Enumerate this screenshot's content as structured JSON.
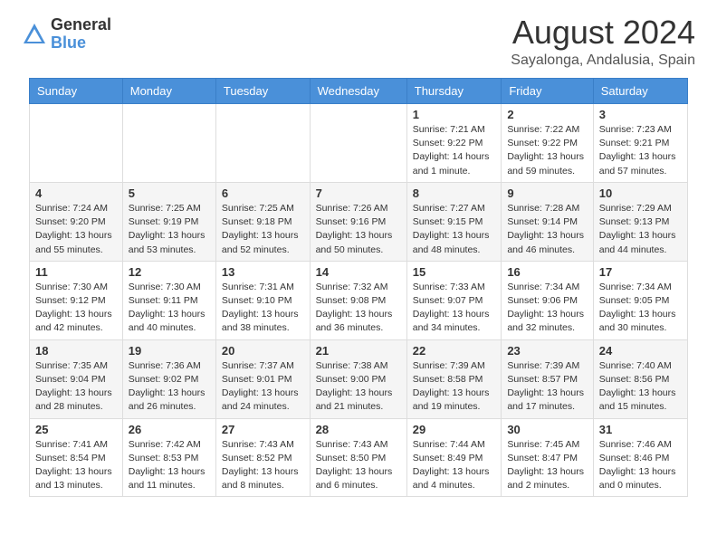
{
  "logo": {
    "general": "General",
    "blue": "Blue"
  },
  "header": {
    "month_year": "August 2024",
    "location": "Sayalonga, Andalusia, Spain"
  },
  "days_of_week": [
    "Sunday",
    "Monday",
    "Tuesday",
    "Wednesday",
    "Thursday",
    "Friday",
    "Saturday"
  ],
  "weeks": [
    [
      {
        "day": "",
        "info": ""
      },
      {
        "day": "",
        "info": ""
      },
      {
        "day": "",
        "info": ""
      },
      {
        "day": "",
        "info": ""
      },
      {
        "day": "1",
        "info": "Sunrise: 7:21 AM\nSunset: 9:22 PM\nDaylight: 14 hours\nand 1 minute."
      },
      {
        "day": "2",
        "info": "Sunrise: 7:22 AM\nSunset: 9:22 PM\nDaylight: 13 hours\nand 59 minutes."
      },
      {
        "day": "3",
        "info": "Sunrise: 7:23 AM\nSunset: 9:21 PM\nDaylight: 13 hours\nand 57 minutes."
      }
    ],
    [
      {
        "day": "4",
        "info": "Sunrise: 7:24 AM\nSunset: 9:20 PM\nDaylight: 13 hours\nand 55 minutes."
      },
      {
        "day": "5",
        "info": "Sunrise: 7:25 AM\nSunset: 9:19 PM\nDaylight: 13 hours\nand 53 minutes."
      },
      {
        "day": "6",
        "info": "Sunrise: 7:25 AM\nSunset: 9:18 PM\nDaylight: 13 hours\nand 52 minutes."
      },
      {
        "day": "7",
        "info": "Sunrise: 7:26 AM\nSunset: 9:16 PM\nDaylight: 13 hours\nand 50 minutes."
      },
      {
        "day": "8",
        "info": "Sunrise: 7:27 AM\nSunset: 9:15 PM\nDaylight: 13 hours\nand 48 minutes."
      },
      {
        "day": "9",
        "info": "Sunrise: 7:28 AM\nSunset: 9:14 PM\nDaylight: 13 hours\nand 46 minutes."
      },
      {
        "day": "10",
        "info": "Sunrise: 7:29 AM\nSunset: 9:13 PM\nDaylight: 13 hours\nand 44 minutes."
      }
    ],
    [
      {
        "day": "11",
        "info": "Sunrise: 7:30 AM\nSunset: 9:12 PM\nDaylight: 13 hours\nand 42 minutes."
      },
      {
        "day": "12",
        "info": "Sunrise: 7:30 AM\nSunset: 9:11 PM\nDaylight: 13 hours\nand 40 minutes."
      },
      {
        "day": "13",
        "info": "Sunrise: 7:31 AM\nSunset: 9:10 PM\nDaylight: 13 hours\nand 38 minutes."
      },
      {
        "day": "14",
        "info": "Sunrise: 7:32 AM\nSunset: 9:08 PM\nDaylight: 13 hours\nand 36 minutes."
      },
      {
        "day": "15",
        "info": "Sunrise: 7:33 AM\nSunset: 9:07 PM\nDaylight: 13 hours\nand 34 minutes."
      },
      {
        "day": "16",
        "info": "Sunrise: 7:34 AM\nSunset: 9:06 PM\nDaylight: 13 hours\nand 32 minutes."
      },
      {
        "day": "17",
        "info": "Sunrise: 7:34 AM\nSunset: 9:05 PM\nDaylight: 13 hours\nand 30 minutes."
      }
    ],
    [
      {
        "day": "18",
        "info": "Sunrise: 7:35 AM\nSunset: 9:04 PM\nDaylight: 13 hours\nand 28 minutes."
      },
      {
        "day": "19",
        "info": "Sunrise: 7:36 AM\nSunset: 9:02 PM\nDaylight: 13 hours\nand 26 minutes."
      },
      {
        "day": "20",
        "info": "Sunrise: 7:37 AM\nSunset: 9:01 PM\nDaylight: 13 hours\nand 24 minutes."
      },
      {
        "day": "21",
        "info": "Sunrise: 7:38 AM\nSunset: 9:00 PM\nDaylight: 13 hours\nand 21 minutes."
      },
      {
        "day": "22",
        "info": "Sunrise: 7:39 AM\nSunset: 8:58 PM\nDaylight: 13 hours\nand 19 minutes."
      },
      {
        "day": "23",
        "info": "Sunrise: 7:39 AM\nSunset: 8:57 PM\nDaylight: 13 hours\nand 17 minutes."
      },
      {
        "day": "24",
        "info": "Sunrise: 7:40 AM\nSunset: 8:56 PM\nDaylight: 13 hours\nand 15 minutes."
      }
    ],
    [
      {
        "day": "25",
        "info": "Sunrise: 7:41 AM\nSunset: 8:54 PM\nDaylight: 13 hours\nand 13 minutes."
      },
      {
        "day": "26",
        "info": "Sunrise: 7:42 AM\nSunset: 8:53 PM\nDaylight: 13 hours\nand 11 minutes."
      },
      {
        "day": "27",
        "info": "Sunrise: 7:43 AM\nSunset: 8:52 PM\nDaylight: 13 hours\nand 8 minutes."
      },
      {
        "day": "28",
        "info": "Sunrise: 7:43 AM\nSunset: 8:50 PM\nDaylight: 13 hours\nand 6 minutes."
      },
      {
        "day": "29",
        "info": "Sunrise: 7:44 AM\nSunset: 8:49 PM\nDaylight: 13 hours\nand 4 minutes."
      },
      {
        "day": "30",
        "info": "Sunrise: 7:45 AM\nSunset: 8:47 PM\nDaylight: 13 hours\nand 2 minutes."
      },
      {
        "day": "31",
        "info": "Sunrise: 7:46 AM\nSunset: 8:46 PM\nDaylight: 13 hours\nand 0 minutes."
      }
    ]
  ]
}
